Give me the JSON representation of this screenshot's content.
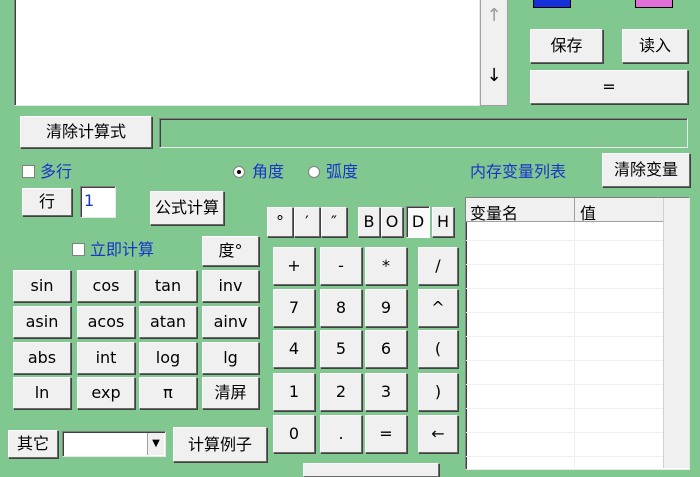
{
  "top": {
    "scroll_up": "↑",
    "scroll_down": "↓",
    "save": "保存",
    "load": "读入",
    "equals_main": "="
  },
  "formula_bar": {
    "clear_expr": "清除计算式",
    "expr_value": ""
  },
  "options": {
    "multiline": "多行",
    "degree": "角度",
    "radian": "弧度",
    "row_button": "行",
    "row_value": "1",
    "formula_calc": "公式计算",
    "instant_calc": "立即计算",
    "deg_button": "度°"
  },
  "variables": {
    "title": "内存变量列表",
    "clear_vars": "清除变量",
    "col_name": "变量名",
    "col_value": "值"
  },
  "func_keys": [
    "sin",
    "cos",
    "tan",
    "inv",
    "asin",
    "acos",
    "atan",
    "ainv",
    "abs",
    "int",
    "log",
    "lg",
    "ln",
    "exp",
    "π",
    "清屏"
  ],
  "angle_keys": [
    "°",
    "′",
    "″"
  ],
  "base_keys": [
    "B",
    "O",
    "D",
    "H"
  ],
  "num_keys": [
    "+",
    "-",
    "*",
    "/",
    "7",
    "8",
    "9",
    "^",
    "4",
    "5",
    "6",
    "(",
    "1",
    "2",
    "3",
    ")",
    "0",
    ".",
    "=",
    "←"
  ],
  "bottom": {
    "other": "其它",
    "other_select": "",
    "example_calc": "计算例子"
  },
  "colors": {
    "background": "#80c890",
    "label_blue": "#1a34c8",
    "button_face": "#f0f0f0"
  }
}
